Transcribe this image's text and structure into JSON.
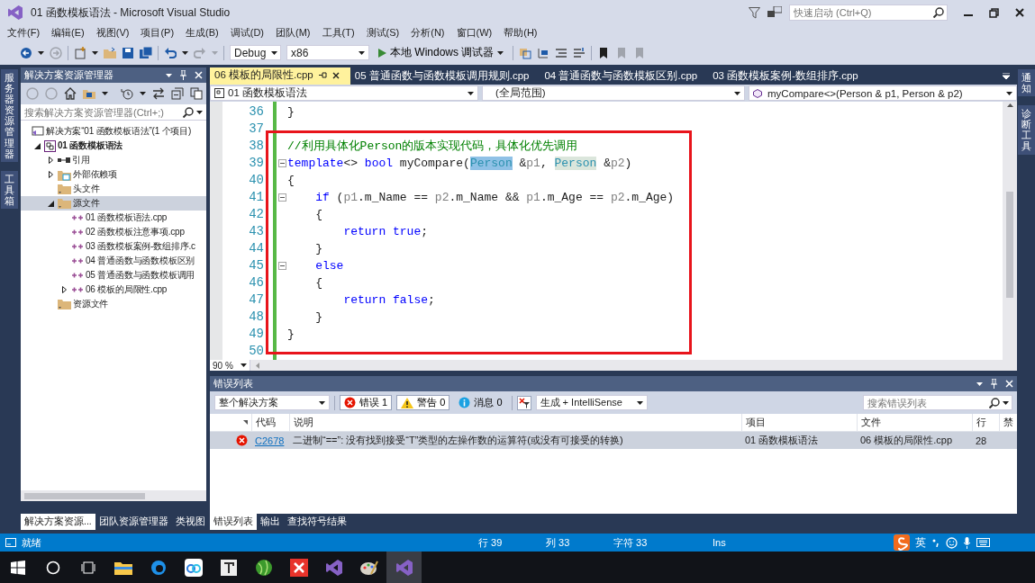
{
  "window": {
    "title": "01 函数模板语法 - Microsoft Visual Studio",
    "quick_launch": {
      "placeholder": "快速启动 (Ctrl+Q)"
    }
  },
  "menu": [
    "文件(F)",
    "编辑(E)",
    "视图(V)",
    "项目(P)",
    "生成(B)",
    "调试(D)",
    "团队(M)",
    "工具(T)",
    "测试(S)",
    "分析(N)",
    "窗口(W)",
    "帮助(H)"
  ],
  "toolbar": {
    "configuration": "Debug",
    "platform": "x86",
    "run_button": "本地 Windows 调试器"
  },
  "left_rail": [
    "服务器资源管理器",
    "工具箱"
  ],
  "right_rail": [
    "通知",
    "诊断工具"
  ],
  "solution_explorer": {
    "title": "解决方案资源管理器",
    "search": {
      "placeholder": "搜索解决方案资源管理器(Ctrl+;)"
    },
    "tree": [
      {
        "kind": "solution",
        "label": "解决方案“01 函数模板语法”(1 个项目)",
        "selected": false,
        "children": [
          {
            "kind": "project",
            "label": "01 函数模板语法",
            "expanded": true,
            "selected": false,
            "children": [
              {
                "kind": "references",
                "label": "引用",
                "expanded": false,
                "selected": false
              },
              {
                "kind": "external",
                "label": "外部依赖项",
                "expanded": false,
                "selected": false
              },
              {
                "kind": "folder",
                "label": "头文件",
                "selected": false
              },
              {
                "kind": "folder",
                "label": "源文件",
                "expanded": true,
                "selected": true,
                "children": [
                  {
                    "kind": "file",
                    "label": "01 函数模板语法.cpp",
                    "selected": false
                  },
                  {
                    "kind": "file",
                    "label": "02 函数模板注意事项.cpp",
                    "selected": false
                  },
                  {
                    "kind": "file",
                    "label": "03 函数模板案例-数组排序.c",
                    "selected": false
                  },
                  {
                    "kind": "file",
                    "label": "04 普通函数与函数模板区别",
                    "selected": false
                  },
                  {
                    "kind": "file",
                    "label": "05 普通函数与函数模板调用",
                    "selected": false
                  },
                  {
                    "kind": "file",
                    "label": "06 模板的局限性.cpp",
                    "expanded": false,
                    "selected": false
                  }
                ]
              },
              {
                "kind": "folder",
                "label": "资源文件",
                "selected": false
              }
            ]
          }
        ]
      }
    ],
    "tabs": [
      {
        "label": "解决方案资源...",
        "selected": true
      },
      {
        "label": "团队资源管理器",
        "selected": false
      },
      {
        "label": "类视图",
        "selected": false
      }
    ]
  },
  "editor": {
    "tabs": [
      {
        "label": "06 模板的局限性.cpp",
        "selected": true
      },
      {
        "label": "05 普通函数与函数模板调用规则.cpp",
        "selected": false
      },
      {
        "label": "04 普通函数与函数模板区别.cpp",
        "selected": false
      },
      {
        "label": "03 函数模板案例-数组排序.cpp",
        "selected": false
      }
    ],
    "nav": {
      "project": "01 函数模板语法",
      "scope": "(全局范围)",
      "member": "myCompare<>(Person & p1, Person & p2)"
    },
    "lines": [
      {
        "number": "36",
        "collapsible": false,
        "tokens": [
          {
            "kind": "plain",
            "text": "}"
          }
        ]
      },
      {
        "number": "37",
        "collapsible": false
      },
      {
        "number": "38",
        "collapsible": false,
        "tokens": [
          {
            "kind": "comment",
            "text": "//利用具体化Person的版本实现代码，具体化优先调用"
          }
        ]
      },
      {
        "number": "39",
        "collapsible": true,
        "tokens": [
          {
            "kind": "keyword",
            "text": "template"
          },
          {
            "kind": "plain",
            "text": "<> "
          },
          {
            "kind": "keyword",
            "text": "bool"
          },
          {
            "kind": "plain",
            "text": " myCompare("
          },
          {
            "kind": "selection",
            "text": "Person"
          },
          {
            "kind": "plain",
            "text": " &"
          },
          {
            "kind": "param",
            "text": "p1"
          },
          {
            "kind": "plain",
            "text": ", "
          },
          {
            "kind": "reference",
            "text": "Person"
          },
          {
            "kind": "plain",
            "text": " &"
          },
          {
            "kind": "param",
            "text": "p2"
          },
          {
            "kind": "plain",
            "text": ")"
          }
        ]
      },
      {
        "number": "40",
        "collapsible": false,
        "tokens": [
          {
            "kind": "plain",
            "text": "{"
          }
        ]
      },
      {
        "number": "41",
        "collapsible": true,
        "tokens": [
          {
            "kind": "keyword",
            "text": "    if"
          },
          {
            "kind": "plain",
            "text": " ("
          },
          {
            "kind": "param",
            "text": "p1"
          },
          {
            "kind": "plain",
            "text": ".m_Name == "
          },
          {
            "kind": "param",
            "text": "p2"
          },
          {
            "kind": "plain",
            "text": ".m_Name && "
          },
          {
            "kind": "param",
            "text": "p1"
          },
          {
            "kind": "plain",
            "text": ".m_Age == "
          },
          {
            "kind": "param",
            "text": "p2"
          },
          {
            "kind": "plain",
            "text": ".m_Age)"
          }
        ]
      },
      {
        "number": "42",
        "collapsible": false,
        "tokens": [
          {
            "kind": "plain",
            "text": "    {"
          }
        ]
      },
      {
        "number": "43",
        "collapsible": false,
        "tokens": [
          {
            "kind": "keyword",
            "text": "        return true"
          },
          {
            "kind": "plain",
            "text": ";"
          }
        ]
      },
      {
        "number": "44",
        "collapsible": false,
        "tokens": [
          {
            "kind": "plain",
            "text": "    }"
          }
        ]
      },
      {
        "number": "45",
        "collapsible": true,
        "tokens": [
          {
            "kind": "keyword",
            "text": "    else"
          }
        ]
      },
      {
        "number": "46",
        "collapsible": false,
        "tokens": [
          {
            "kind": "plain",
            "text": "    {"
          }
        ]
      },
      {
        "number": "47",
        "collapsible": false,
        "tokens": [
          {
            "kind": "keyword",
            "text": "        return false"
          },
          {
            "kind": "plain",
            "text": ";"
          }
        ]
      },
      {
        "number": "48",
        "collapsible": false,
        "tokens": [
          {
            "kind": "plain",
            "text": "    }"
          }
        ]
      },
      {
        "number": "49",
        "collapsible": false,
        "tokens": [
          {
            "kind": "plain",
            "text": "}"
          }
        ]
      },
      {
        "number": "50",
        "collapsible": false
      }
    ],
    "zoom": "90 %"
  },
  "error_list": {
    "title": "错误列表",
    "scope": "整个解决方案",
    "filters": [
      {
        "kind": "error",
        "label": "错误 1",
        "selected": true
      },
      {
        "kind": "warning",
        "label": "警告 0",
        "selected": true
      },
      {
        "kind": "message",
        "label": "消息 0",
        "selected": false
      }
    ],
    "source": "生成 + IntelliSense",
    "search": {
      "placeholder": "搜索错误列表"
    },
    "columns": [
      "代码",
      "说明",
      "项目",
      "文件",
      "行",
      "禁"
    ],
    "rows": [
      {
        "kind": "error",
        "code": "C2678",
        "description": "二进制“==”: 没有找到接受“T”类型的左操作数的运算符(或没有可接受的转换)",
        "project": "01 函数模板语法",
        "file": "06 模板的局限性.cpp",
        "line": "28",
        "selected": true
      }
    ],
    "tabs": [
      {
        "label": "错误列表",
        "selected": true
      },
      {
        "label": "输出",
        "selected": false
      },
      {
        "label": "查找符号结果",
        "selected": false
      }
    ]
  },
  "status_bar": {
    "message": "就绪",
    "line": "行 39",
    "column": "列 33",
    "char": "字符 33",
    "mode": "Ins",
    "ime": "英"
  },
  "taskbar": {
    "apps": [
      {
        "kind": "task-view",
        "selected": false
      },
      {
        "kind": "folder",
        "selected": false
      },
      {
        "kind": "browser",
        "selected": false
      },
      {
        "kind": "cloud",
        "selected": false
      },
      {
        "kind": "editor",
        "selected": false
      },
      {
        "kind": "ball",
        "selected": false
      },
      {
        "kind": "mindmap",
        "selected": false
      },
      {
        "kind": "vs",
        "selected": false
      },
      {
        "kind": "paint",
        "selected": false
      },
      {
        "kind": "vs",
        "selected": true
      }
    ]
  }
}
